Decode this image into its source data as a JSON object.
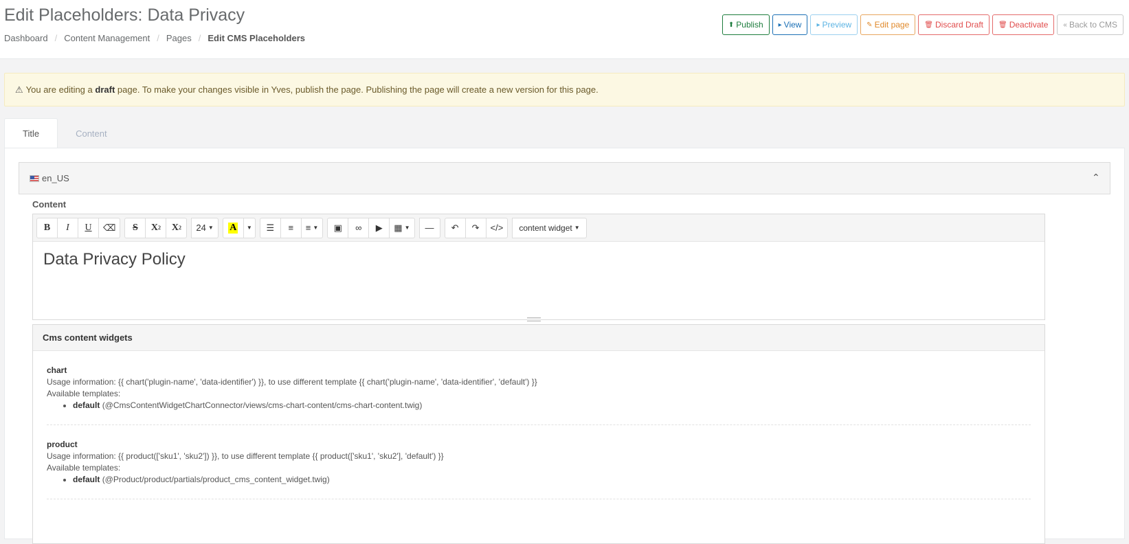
{
  "header": {
    "title": "Edit Placeholders: Data Privacy",
    "breadcrumbs": [
      "Dashboard",
      "Content Management",
      "Pages",
      "Edit CMS Placeholders"
    ]
  },
  "actions": {
    "publish": "Publish",
    "view": "View",
    "preview": "Preview",
    "edit_page": "Edit page",
    "discard_draft": "Discard Draft",
    "deactivate": "Deactivate",
    "back_to_cms": "Back to CMS"
  },
  "alert": {
    "prefix": "You are editing a",
    "bold": "draft",
    "suffix": "page. To make your changes visible in Yves, publish the page. Publishing the page will create a new version for this page."
  },
  "tabs": [
    {
      "label": "Title",
      "active": true
    },
    {
      "label": "Content",
      "active": false
    }
  ],
  "locale": {
    "code": "en_US"
  },
  "editor": {
    "label": "Content",
    "font_size": "24",
    "widget_dropdown": "content widget",
    "body_text": "Data Privacy Policy"
  },
  "widgets": {
    "heading": "Cms content widgets",
    "items": [
      {
        "name": "chart",
        "usage": "Usage information: {{ chart('plugin-name', 'data-identifier') }}, to use different template {{ chart('plugin-name', 'data-identifier', 'default') }}",
        "available_label": "Available templates:",
        "template_name": "default",
        "template_path": "(@CmsContentWidgetChartConnector/views/cms-chart-content/cms-chart-content.twig)"
      },
      {
        "name": "product",
        "usage": "Usage information: {{ product(['sku1', 'sku2']) }}, to use different template {{ product(['sku1', 'sku2'], 'default') }}",
        "available_label": "Available templates:",
        "template_name": "default",
        "template_path": "(@Product/product/partials/product_cms_content_widget.twig)"
      }
    ]
  }
}
